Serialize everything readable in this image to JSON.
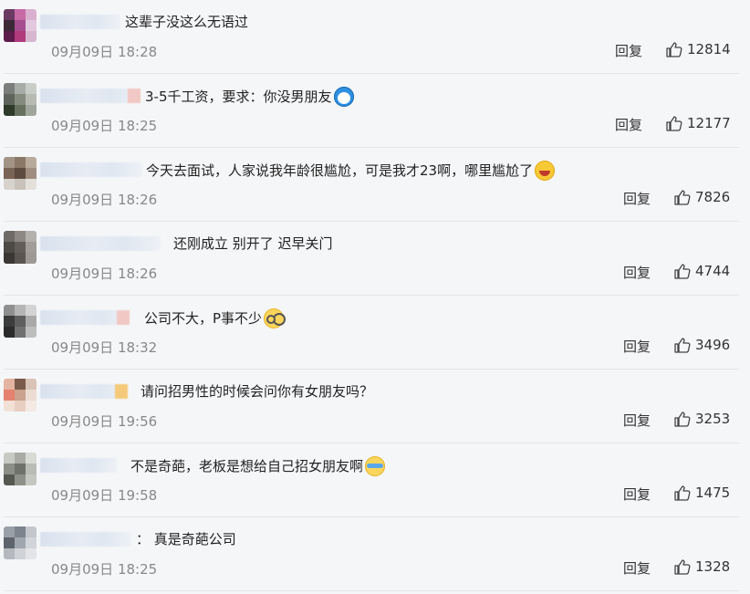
{
  "comments": [
    {
      "text": "这辈子没这么无语过",
      "emoji": "",
      "time": "09月09日 18:28",
      "reply": "回复",
      "likes": "12814"
    },
    {
      "text": "3-5千工资，要求：你没男朋友",
      "emoji": "doraemon",
      "time": "09月09日 18:25",
      "reply": "回复",
      "likes": "12177"
    },
    {
      "text": "今天去面试，人家说我年龄很尴尬，可是我才23啊，哪里尴尬了",
      "emoji": "laugh",
      "time": "09月09日 18:26",
      "reply": "回复",
      "likes": "7826"
    },
    {
      "text": "还刚成立 别开了 迟早关门",
      "emoji": "",
      "time": "09月09日 18:26",
      "reply": "回复",
      "likes": "4744"
    },
    {
      "text": "公司不大，P事不少",
      "emoji": "glasses",
      "time": "09月09日 18:32",
      "reply": "回复",
      "likes": "3496"
    },
    {
      "text": "请问招男性的时候会问你有女朋友吗？",
      "emoji": "",
      "time": "09月09日 19:56",
      "reply": "回复",
      "likes": "3253"
    },
    {
      "text": "不是奇葩，老板是想给自己招女朋友啊",
      "emoji": "cry",
      "time": "09月09日 19:58",
      "reply": "回复",
      "likes": "1475"
    },
    {
      "text": "：  真是奇葩公司",
      "emoji": "",
      "time": "09月09日 18:25",
      "reply": "回复",
      "likes": "1328"
    }
  ]
}
